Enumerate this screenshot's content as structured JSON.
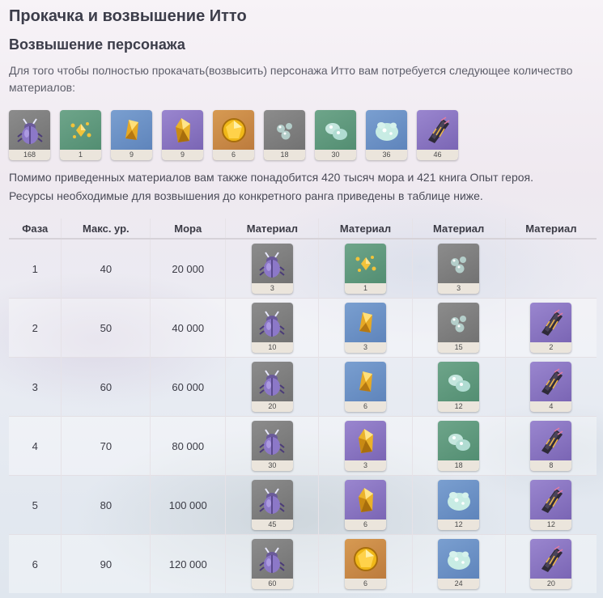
{
  "page": {
    "title": "Прокачка и возвышение Итто",
    "subtitle": "Возвышение персонажа",
    "intro": "Для того чтобы полностью прокачать(возвысить) персонажа Итто вам потребуется следующее количество материалов:",
    "note1": "Помимо приведенных материалов вам также понадобится 420 тысяч мора и 421 книга Опыт героя.",
    "note2": "Ресурсы необходимые для возвышения до конкретного ранга приведены в таблице ниже."
  },
  "materials": [
    {
      "icon": "beetle-icon",
      "rarity": "r1",
      "count": "168"
    },
    {
      "icon": "gem-sliver-icon",
      "rarity": "r2",
      "count": "1"
    },
    {
      "icon": "gem-fragment-icon",
      "rarity": "r3",
      "count": "9"
    },
    {
      "icon": "gem-chunk-icon",
      "rarity": "r4",
      "count": "9"
    },
    {
      "icon": "gem-gemstone-icon",
      "rarity": "r5",
      "count": "6"
    },
    {
      "icon": "slime-condensate-icon",
      "rarity": "r1",
      "count": "18"
    },
    {
      "icon": "slime-secretions-icon",
      "rarity": "r2",
      "count": "30"
    },
    {
      "icon": "slime-concentrate-icon",
      "rarity": "r3",
      "count": "36"
    },
    {
      "icon": "riftborn-regalia-icon",
      "rarity": "r4",
      "count": "46"
    }
  ],
  "table": {
    "headers": [
      "Фаза",
      "Макс. ур.",
      "Мора",
      "Материал",
      "Материал",
      "Материал",
      "Материал"
    ],
    "rows": [
      {
        "phase": "1",
        "level": "40",
        "mora": "20 000",
        "mats": [
          {
            "icon": "beetle-icon",
            "rarity": "r1",
            "count": "3"
          },
          {
            "icon": "gem-sliver-icon",
            "rarity": "r2",
            "count": "1"
          },
          {
            "icon": "slime-condensate-icon",
            "rarity": "r1",
            "count": "3"
          },
          null
        ]
      },
      {
        "phase": "2",
        "level": "50",
        "mora": "40 000",
        "mats": [
          {
            "icon": "beetle-icon",
            "rarity": "r1",
            "count": "10"
          },
          {
            "icon": "gem-fragment-icon",
            "rarity": "r3",
            "count": "3"
          },
          {
            "icon": "slime-condensate-icon",
            "rarity": "r1",
            "count": "15"
          },
          {
            "icon": "riftborn-regalia-icon",
            "rarity": "r4",
            "count": "2"
          }
        ]
      },
      {
        "phase": "3",
        "level": "60",
        "mora": "60 000",
        "mats": [
          {
            "icon": "beetle-icon",
            "rarity": "r1",
            "count": "20"
          },
          {
            "icon": "gem-fragment-icon",
            "rarity": "r3",
            "count": "6"
          },
          {
            "icon": "slime-secretions-icon",
            "rarity": "r2",
            "count": "12"
          },
          {
            "icon": "riftborn-regalia-icon",
            "rarity": "r4",
            "count": "4"
          }
        ]
      },
      {
        "phase": "4",
        "level": "70",
        "mora": "80 000",
        "mats": [
          {
            "icon": "beetle-icon",
            "rarity": "r1",
            "count": "30"
          },
          {
            "icon": "gem-chunk-icon",
            "rarity": "r4",
            "count": "3"
          },
          {
            "icon": "slime-secretions-icon",
            "rarity": "r2",
            "count": "18"
          },
          {
            "icon": "riftborn-regalia-icon",
            "rarity": "r4",
            "count": "8"
          }
        ]
      },
      {
        "phase": "5",
        "level": "80",
        "mora": "100 000",
        "mats": [
          {
            "icon": "beetle-icon",
            "rarity": "r1",
            "count": "45"
          },
          {
            "icon": "gem-chunk-icon",
            "rarity": "r4",
            "count": "6"
          },
          {
            "icon": "slime-concentrate-icon",
            "rarity": "r3",
            "count": "12"
          },
          {
            "icon": "riftborn-regalia-icon",
            "rarity": "r4",
            "count": "12"
          }
        ]
      },
      {
        "phase": "6",
        "level": "90",
        "mora": "120 000",
        "mats": [
          {
            "icon": "beetle-icon",
            "rarity": "r1",
            "count": "60"
          },
          {
            "icon": "gem-gemstone-icon",
            "rarity": "r5",
            "count": "6"
          },
          {
            "icon": "slime-concentrate-icon",
            "rarity": "r3",
            "count": "24"
          },
          {
            "icon": "riftborn-regalia-icon",
            "rarity": "r4",
            "count": "20"
          }
        ]
      }
    ]
  }
}
